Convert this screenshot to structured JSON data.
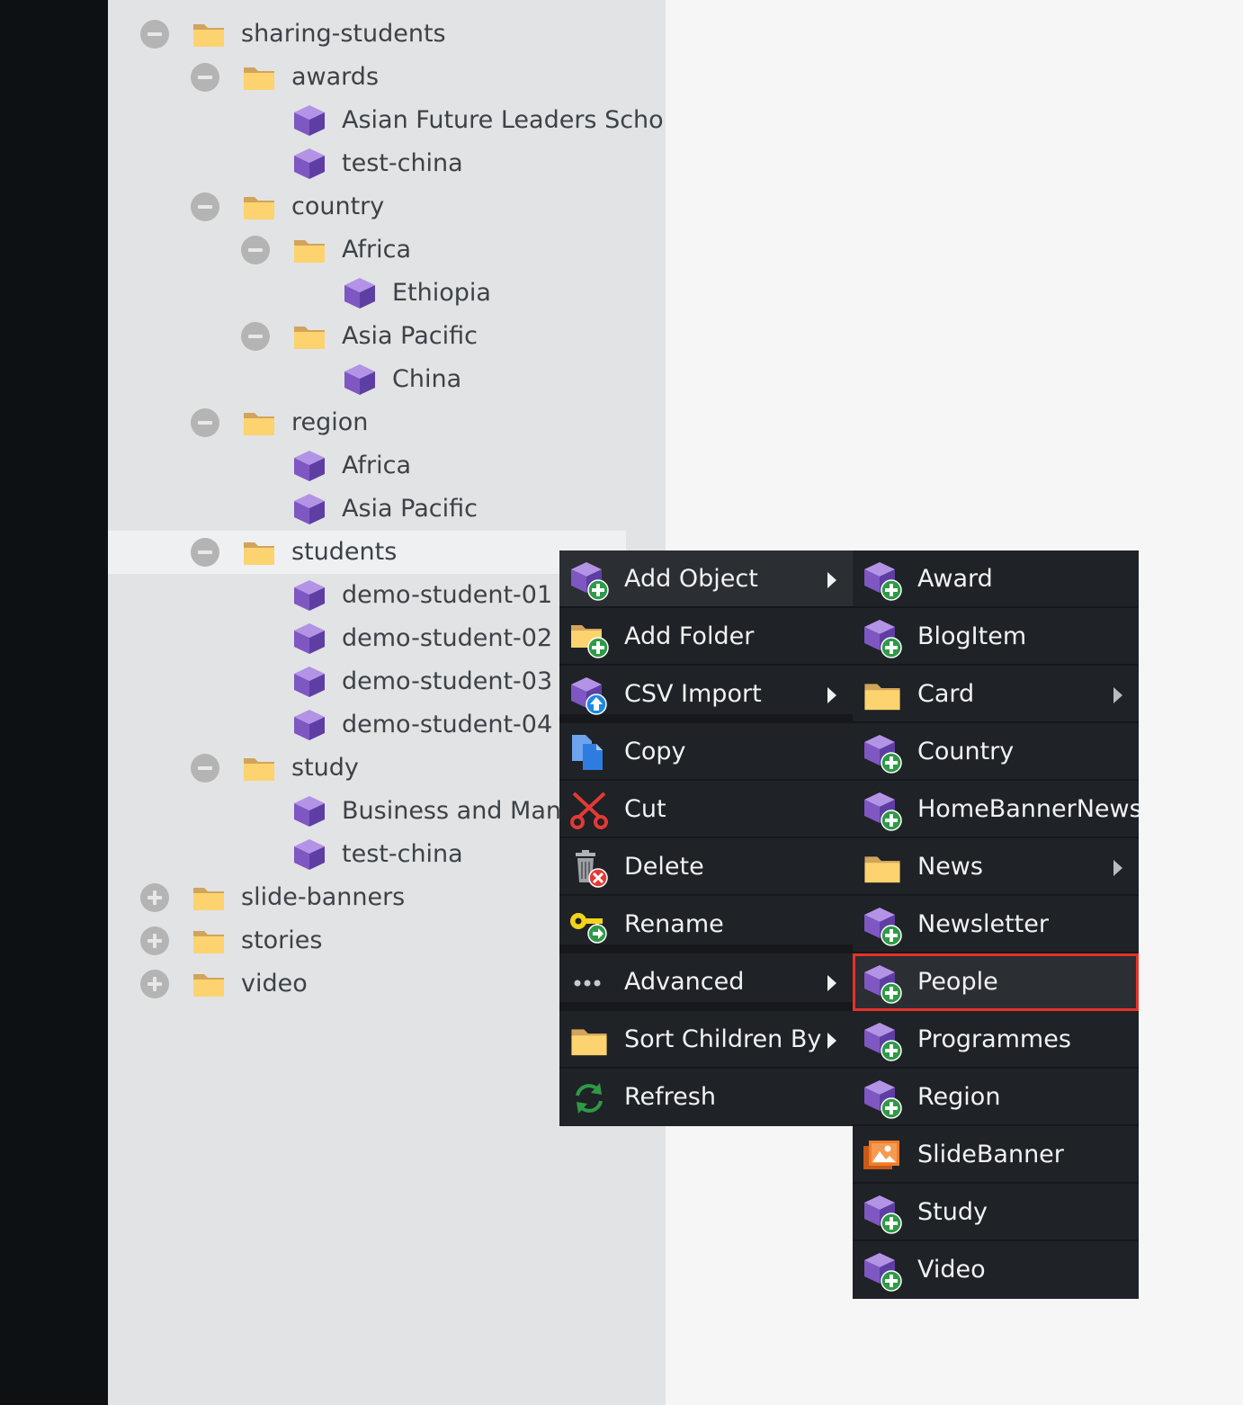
{
  "tree": {
    "rows": [
      {
        "label": "sharing-students",
        "kind": "folder",
        "toggle": "minus",
        "depth": 0
      },
      {
        "label": "awards",
        "kind": "folder",
        "toggle": "minus",
        "depth": 1
      },
      {
        "label": "Asian Future Leaders Schola",
        "kind": "object",
        "depth": 2
      },
      {
        "label": "test-china",
        "kind": "object",
        "depth": 2
      },
      {
        "label": "country",
        "kind": "folder",
        "toggle": "minus",
        "depth": 1
      },
      {
        "label": "Africa",
        "kind": "folder",
        "toggle": "minus",
        "depth": 2
      },
      {
        "label": "Ethiopia",
        "kind": "object",
        "depth": 3
      },
      {
        "label": "Asia Pacific",
        "kind": "folder",
        "toggle": "minus",
        "depth": 2
      },
      {
        "label": "China",
        "kind": "object",
        "depth": 3
      },
      {
        "label": "region",
        "kind": "folder",
        "toggle": "minus",
        "depth": 1
      },
      {
        "label": "Africa",
        "kind": "object",
        "depth": 2
      },
      {
        "label": "Asia Pacific",
        "kind": "object",
        "depth": 2
      },
      {
        "label": "students",
        "kind": "folder",
        "toggle": "minus",
        "depth": 1,
        "selected": true
      },
      {
        "label": "demo-student-01",
        "kind": "object",
        "depth": 2
      },
      {
        "label": "demo-student-02",
        "kind": "object",
        "depth": 2
      },
      {
        "label": "demo-student-03",
        "kind": "object",
        "depth": 2
      },
      {
        "label": "demo-student-04",
        "kind": "object",
        "depth": 2
      },
      {
        "label": "study",
        "kind": "folder",
        "toggle": "minus",
        "depth": 1
      },
      {
        "label": "Business and Manag",
        "kind": "object",
        "depth": 2
      },
      {
        "label": "test-china",
        "kind": "object",
        "depth": 2
      },
      {
        "label": "slide-banners",
        "kind": "folder",
        "toggle": "plus",
        "depth": 0
      },
      {
        "label": "stories",
        "kind": "folder",
        "toggle": "plus",
        "depth": 0
      },
      {
        "label": "video",
        "kind": "folder",
        "toggle": "plus",
        "depth": 0
      }
    ]
  },
  "context_menu": {
    "items": [
      {
        "label": "Add Object",
        "icon": "cube-plus-icon",
        "has_submenu": true,
        "active": true
      },
      {
        "label": "Add Folder",
        "icon": "folder-plus-icon"
      },
      {
        "label": "CSV Import",
        "icon": "cube-upload-icon",
        "has_submenu": true,
        "separator_after": true
      },
      {
        "label": "Copy",
        "icon": "copy-icon"
      },
      {
        "label": "Cut",
        "icon": "scissors-icon"
      },
      {
        "label": "Delete",
        "icon": "trash-icon"
      },
      {
        "label": "Rename",
        "icon": "key-icon",
        "separator_after": true
      },
      {
        "label": "Advanced",
        "icon": "ellipsis-icon",
        "has_submenu": true,
        "separator_after": true
      },
      {
        "label": "Sort Children By",
        "icon": "folder-icon",
        "has_submenu": true
      },
      {
        "label": "Refresh",
        "icon": "refresh-icon"
      }
    ]
  },
  "submenu": {
    "items": [
      {
        "label": "Award",
        "icon": "cube-plus-icon"
      },
      {
        "label": "BlogItem",
        "icon": "cube-plus-icon"
      },
      {
        "label": "Card",
        "icon": "folder-icon",
        "has_submenu": true
      },
      {
        "label": "Country",
        "icon": "cube-plus-icon"
      },
      {
        "label": "HomeBannerNews",
        "icon": "cube-plus-icon"
      },
      {
        "label": "News",
        "icon": "folder-icon",
        "has_submenu": true
      },
      {
        "label": "Newsletter",
        "icon": "cube-plus-icon"
      },
      {
        "label": "People",
        "icon": "cube-plus-icon",
        "highlighted": true
      },
      {
        "label": "Programmes",
        "icon": "cube-plus-icon"
      },
      {
        "label": "Region",
        "icon": "cube-plus-icon"
      },
      {
        "label": "SlideBanner",
        "icon": "image-icon"
      },
      {
        "label": "Study",
        "icon": "cube-plus-icon"
      },
      {
        "label": "Video",
        "icon": "cube-plus-icon"
      }
    ]
  },
  "colors": {
    "highlight_outline": "#e53327",
    "menu_bg": "#1f2226",
    "tree_bg": "#e2e3e4"
  }
}
